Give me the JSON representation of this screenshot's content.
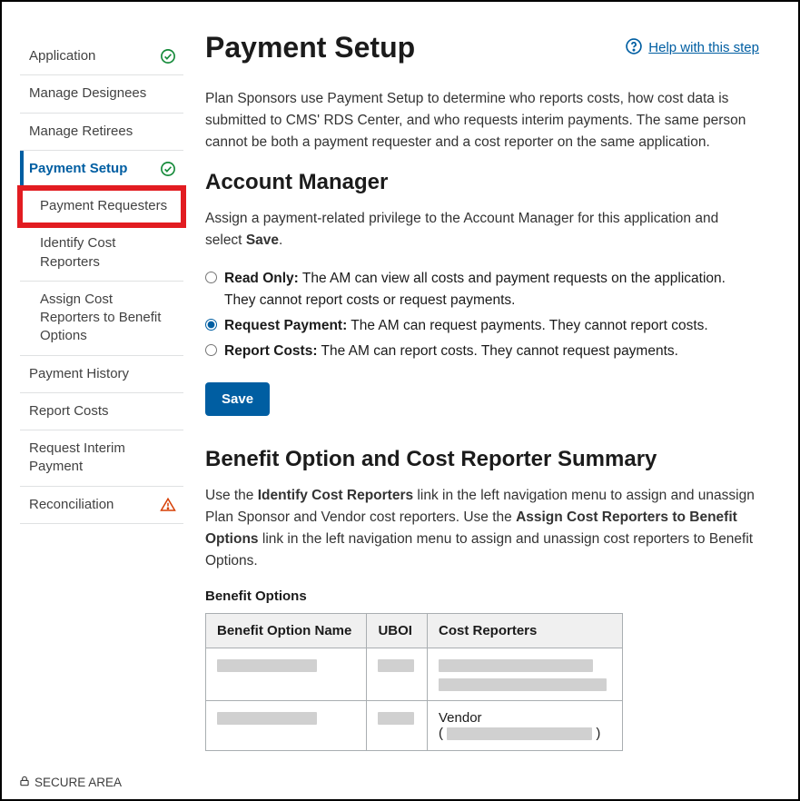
{
  "header": {
    "title": "Payment Setup",
    "help_label": "Help with this step"
  },
  "sidebar": {
    "items": [
      {
        "label": "Application",
        "status": "check"
      },
      {
        "label": "Manage Designees"
      },
      {
        "label": "Manage Retirees"
      },
      {
        "label": "Payment Setup",
        "status": "check",
        "active": true
      },
      {
        "label": "Payment History"
      },
      {
        "label": "Report Costs"
      },
      {
        "label": "Request Interim Payment"
      },
      {
        "label": "Reconciliation",
        "status": "warn"
      }
    ],
    "subitems": [
      {
        "label": "Payment Requesters",
        "highlight": true
      },
      {
        "label": "Identify Cost Reporters"
      },
      {
        "label": "Assign Cost Reporters to Benefit Options"
      }
    ]
  },
  "intro": "Plan Sponsors use Payment Setup to determine who reports costs, how cost data is submitted to CMS' RDS Center, and who requests interim payments. The same person cannot be both a payment requester and a cost reporter on the same application.",
  "am": {
    "heading": "Account Manager",
    "instruction_pre": "Assign a payment-related privilege to the Account Manager for this application and select ",
    "instruction_bold": "Save",
    "instruction_post": ".",
    "options": [
      {
        "label": "Read Only:",
        "desc": " The AM can view all costs and payment requests on the application. They cannot report costs or request payments.",
        "checked": false
      },
      {
        "label": "Request Payment:",
        "desc": " The AM can request payments. They cannot report costs.",
        "checked": true
      },
      {
        "label": "Report Costs:",
        "desc": " The AM can report costs. They cannot request payments.",
        "checked": false
      }
    ],
    "save_label": "Save"
  },
  "summary": {
    "heading": "Benefit Option and Cost Reporter Summary",
    "p1_a": "Use the ",
    "p1_b": "Identify Cost Reporters",
    "p1_c": " link in the left navigation menu to assign and unassign Plan Sponsor and Vendor cost reporters. Use the ",
    "p1_d": "Assign Cost Reporters to Benefit Options",
    "p1_e": " link in the left navigation menu to assign and unassign cost reporters to Benefit Options.",
    "caption": "Benefit Options",
    "cols": [
      "Benefit Option Name",
      "UBOI",
      "Cost Reporters"
    ],
    "row2_vendor": "Vendor"
  },
  "footer": "SECURE AREA"
}
